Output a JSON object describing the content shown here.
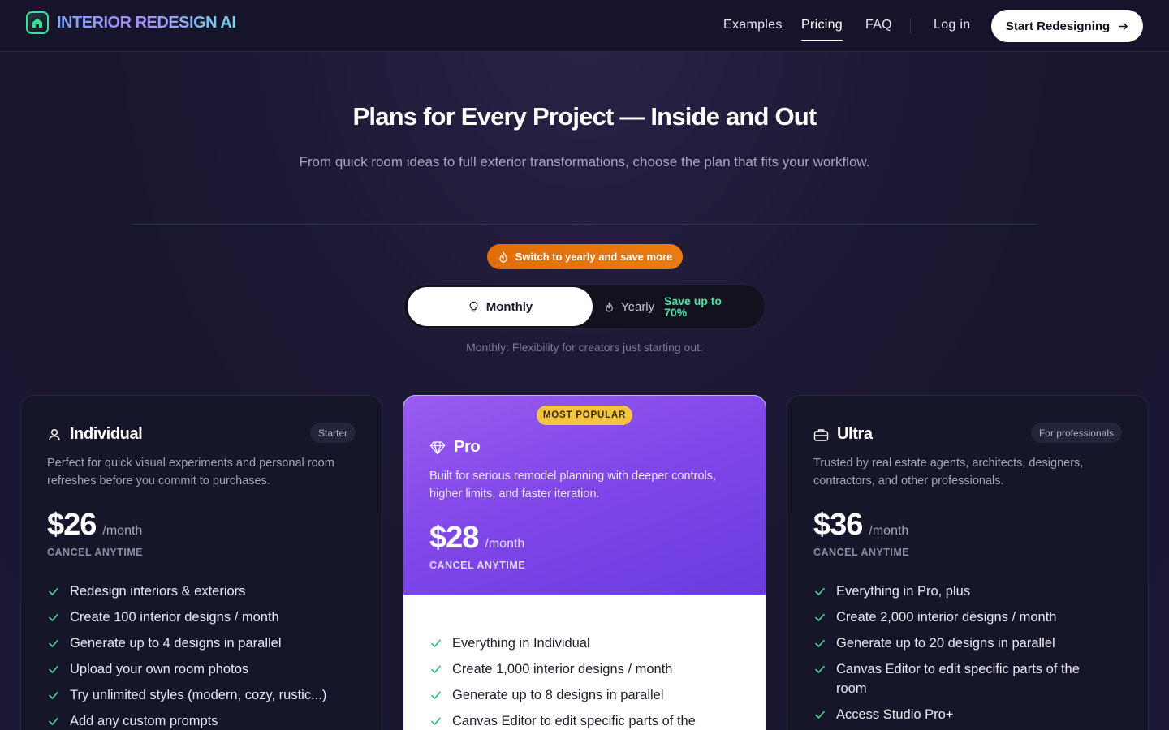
{
  "brand": {
    "name": "INTERIOR REDESIGN AI"
  },
  "nav": {
    "examples": "Examples",
    "pricing": "Pricing",
    "faq": "FAQ",
    "login": "Log in",
    "cta": "Start Redesigning"
  },
  "hero": {
    "title": "Plans for Every Project — Inside and Out",
    "subtitle": "From quick room ideas to full exterior transformations, choose the plan that fits your workflow."
  },
  "billing": {
    "promo": "Switch to yearly and save more",
    "monthly_label": "Monthly",
    "yearly_label": "Yearly",
    "yearly_save": "Save up to 70%",
    "selected": "Monthly",
    "caption": "Monthly: Flexibility for creators just starting out."
  },
  "plans": [
    {
      "name": "Individual",
      "tag": "Starter",
      "description": "Perfect for quick visual experiments and personal room refreshes before you commit to purchases.",
      "price": "$26",
      "period": "/month",
      "note": "CANCEL ANYTIME",
      "features": [
        "Redesign interiors & exteriors",
        "Create 100 interior designs / month",
        "Generate up to 4 designs in parallel",
        "Upload your own room photos",
        "Try unlimited styles (modern, cozy, rustic...)",
        "Add any custom prompts"
      ]
    },
    {
      "name": "Pro",
      "badge": "MOST POPULAR",
      "description": "Built for serious remodel planning with deeper controls, higher limits, and faster iteration.",
      "price": "$28",
      "period": "/month",
      "note": "CANCEL ANYTIME",
      "features": [
        "Everything in Individual",
        "Create 1,000 interior designs / month",
        "Generate up to 8 designs in parallel",
        "Canvas Editor to edit specific parts of the"
      ]
    },
    {
      "name": "Ultra",
      "tag": "For professionals",
      "description": "Trusted by real estate agents, architects, designers, contractors, and other professionals.",
      "price": "$36",
      "period": "/month",
      "note": "CANCEL ANYTIME",
      "features": [
        "Everything in Pro, plus",
        "Create 2,000 interior designs / month",
        "Generate up to 20 designs in parallel",
        "Canvas Editor to edit specific parts of the room",
        "Access Studio Pro+"
      ]
    }
  ],
  "colors": {
    "accent_green": "#3ddc97",
    "promo_orange": "#e06f0a",
    "pro_purple": "#7f46e8",
    "badge_yellow": "#f4c541",
    "save_green": "#4ee0a0"
  },
  "icons": {
    "logo": "home-icon",
    "cta": "arrow-right-icon",
    "promo": "flame-icon",
    "monthly": "lightbulb-icon",
    "yearly": "flame-icon",
    "individual": "user-icon",
    "pro": "diamond-icon",
    "ultra": "briefcase-icon",
    "feature": "check-icon"
  }
}
